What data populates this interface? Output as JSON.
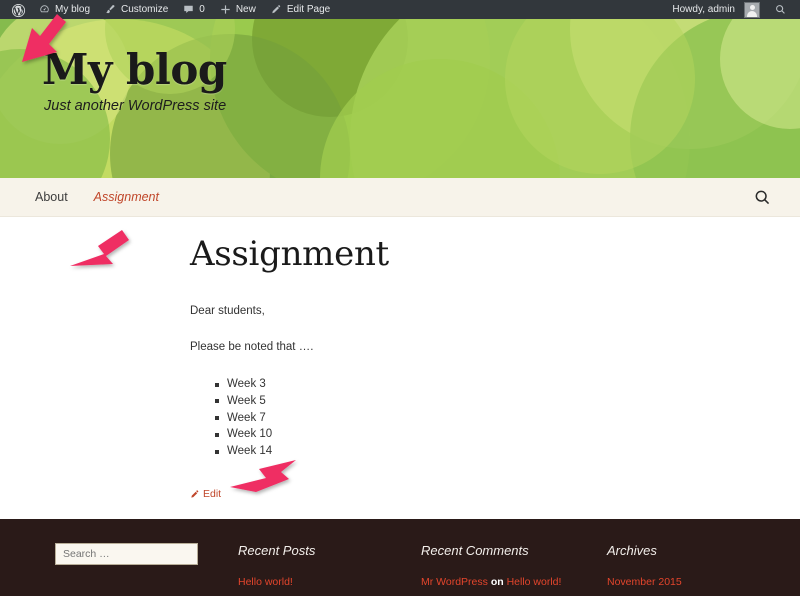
{
  "adminbar": {
    "wp_logo_icon": "wordpress-logo-icon",
    "items": [
      {
        "icon": "dashboard-icon",
        "label": "My blog"
      },
      {
        "icon": "paintbrush-icon",
        "label": "Customize"
      },
      {
        "icon": "comment-bubble-icon",
        "label": "0"
      },
      {
        "icon": "plus-icon",
        "label": "New"
      },
      {
        "icon": "pencil-icon",
        "label": "Edit Page"
      }
    ],
    "howdy": "Howdy, admin",
    "avatar_icon": "user-avatar-icon",
    "search_icon": "search-icon"
  },
  "site": {
    "title": "My blog",
    "tagline": "Just another WordPress site",
    "header_colors": {
      "base": "#84bb4c",
      "light": "#c3dd6f",
      "mid": "#9bcc4f",
      "dark": "#6c9a35",
      "pale": "#d8e98a"
    }
  },
  "nav": {
    "items": [
      {
        "label": "About",
        "current": false
      },
      {
        "label": "Assignment",
        "current": true
      }
    ],
    "search_icon": "search-icon",
    "accent_color": "#c0462a"
  },
  "main": {
    "entry_title": "Assignment",
    "paragraphs": [
      "Dear students,",
      "Please be noted that …."
    ],
    "list_items": [
      "Week 3",
      "Week 5",
      "Week 7",
      "Week 10",
      "Week 14"
    ],
    "edit": {
      "icon": "pencil-icon",
      "label": "Edit"
    }
  },
  "footer": {
    "background_color": "#2a1a18",
    "link_color": "#e3452c",
    "search": {
      "placeholder": "Search …",
      "value": ""
    },
    "widgets": [
      {
        "title": "Recent Posts",
        "links": [
          "Hello world!"
        ]
      },
      {
        "title": "Recent Comments",
        "comment_author": "Mr WordPress",
        "comment_on": "on",
        "comment_post": "Hello world!"
      },
      {
        "title": "Archives",
        "links": [
          "November 2015"
        ]
      }
    ]
  },
  "annotations": {
    "color": "#ef2d63",
    "arrows": [
      {
        "name": "arrow-to-my-blog",
        "target": "My blog"
      },
      {
        "name": "arrow-to-assignment-nav",
        "target": "Assignment"
      },
      {
        "name": "arrow-to-edit-link",
        "target": "Edit"
      }
    ]
  }
}
